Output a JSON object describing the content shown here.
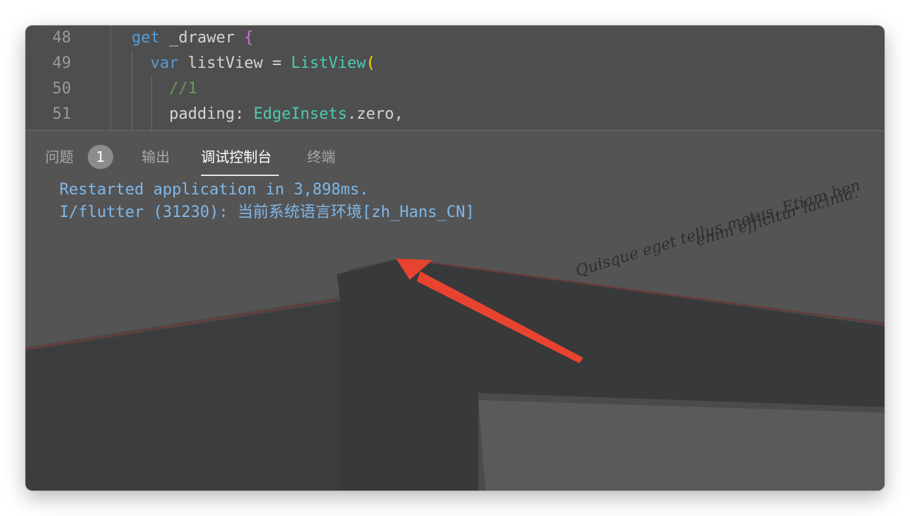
{
  "editor": {
    "lines": [
      {
        "number": "48",
        "tokens": [
          {
            "t": "get",
            "c": "kw"
          },
          {
            "t": " _drawer ",
            "c": ""
          },
          {
            "t": "{",
            "c": "br"
          }
        ]
      },
      {
        "number": "49",
        "tokens": [
          {
            "t": "  var",
            "c": "kw"
          },
          {
            "t": " listView = ",
            "c": ""
          },
          {
            "t": "ListView",
            "c": "ty"
          },
          {
            "t": "(",
            "c": "bp"
          }
        ]
      },
      {
        "number": "50",
        "tokens": [
          {
            "t": "    //1",
            "c": "cm"
          }
        ]
      },
      {
        "number": "51",
        "tokens": [
          {
            "t": "    padding: ",
            "c": ""
          },
          {
            "t": "EdgeInsets",
            "c": "ty"
          },
          {
            "t": ".zero,",
            "c": ""
          }
        ]
      }
    ]
  },
  "panel": {
    "tabs": [
      {
        "label": "问题",
        "active": false
      },
      {
        "label": "输出",
        "active": false
      },
      {
        "label": "调试控制台",
        "active": true
      },
      {
        "label": "终端",
        "active": false
      }
    ],
    "problems_badge": "1",
    "console_lines": [
      "Restarted application in 3,898ms.",
      "I/flutter (31230): 当前系统语言环境[zh_Hans_CN]"
    ]
  },
  "background_text": {
    "line1": "Quisque eget tellus metus. Etiam hen",
    "line2": "enim efficitur lacinia."
  },
  "colors": {
    "console_text": "#7fb8e8",
    "keyword": "#569cd6",
    "type": "#4ec9b0",
    "comment": "#6a9955",
    "arrow": "#e8432f"
  }
}
